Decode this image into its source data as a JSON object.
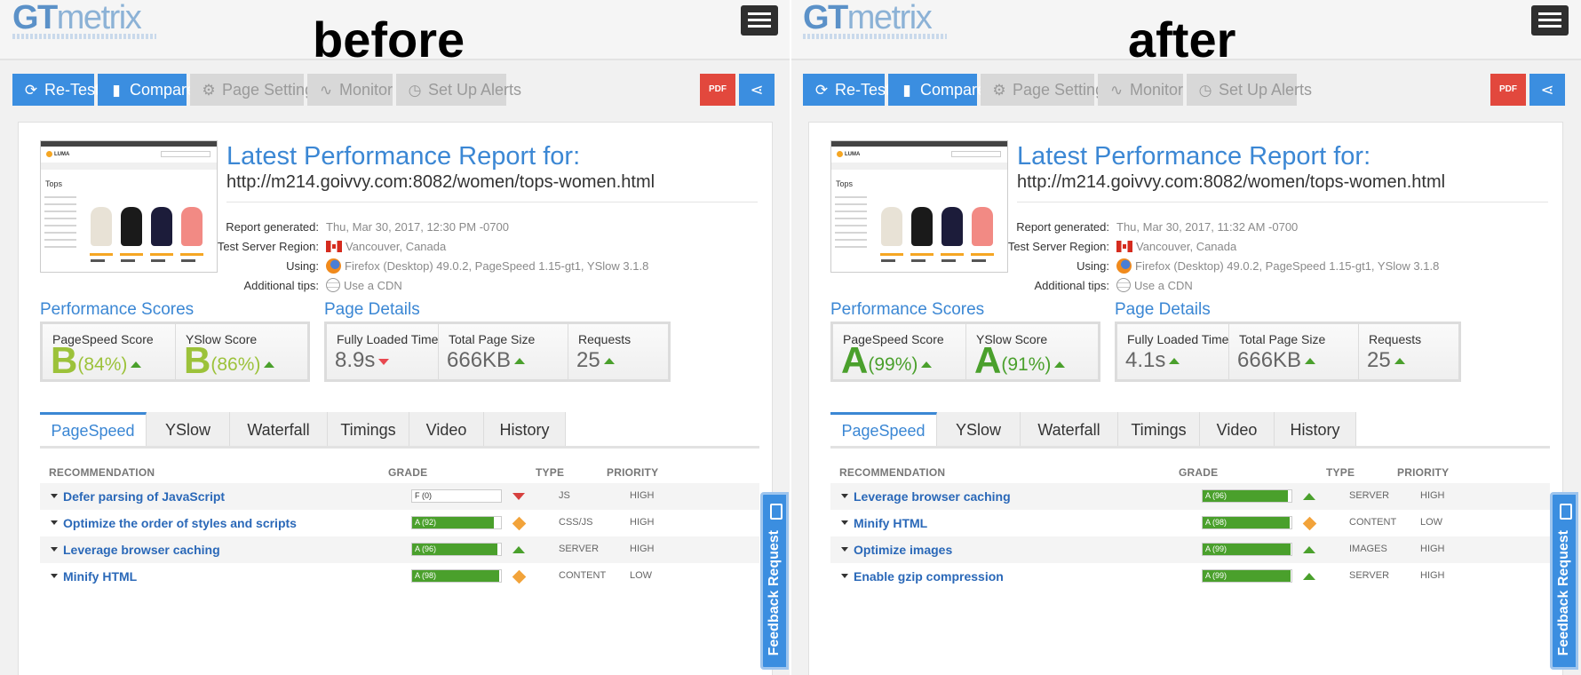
{
  "panels": [
    {
      "banner": "before",
      "logo": {
        "gt": "GT",
        "metrix": "metrix"
      },
      "toolbar": {
        "retest": "Re-Test",
        "compare": "Compare",
        "page_settings": "Page Settings",
        "monitor": "Monitor",
        "alerts": "Set Up Alerts",
        "pdf": "PDF"
      },
      "report": {
        "title": "Latest Performance Report for:",
        "url": "http://m214.goivvy.com:8082/women/tops-women.html"
      },
      "meta": {
        "generated_label": "Report generated:",
        "generated_value": "Thu, Mar 30, 2017, 12:30 PM -0700",
        "region_label": "Test Server Region:",
        "region_value": "Vancouver, Canada",
        "using_label": "Using:",
        "using_value": "Firefox (Desktop) 49.0.2, PageSpeed 1.15-gt1, YSlow 3.1.8",
        "tips_label": "Additional tips:",
        "tips_value": "Use a CDN"
      },
      "scores": {
        "title": "Performance Scores",
        "pagespeed_label": "PageSpeed Score",
        "pagespeed_grade": "B",
        "pagespeed_pct": "(84%)",
        "yslow_label": "YSlow Score",
        "yslow_grade": "B",
        "yslow_pct": "(86%)"
      },
      "details": {
        "title": "Page Details",
        "load_label": "Fully Loaded Time",
        "load_value": "8.9s",
        "load_trend": "down",
        "size_label": "Total Page Size",
        "size_value": "666KB",
        "req_label": "Requests",
        "req_value": "25"
      },
      "tabs": [
        "PageSpeed",
        "YSlow",
        "Waterfall",
        "Timings",
        "Video",
        "History"
      ],
      "table": {
        "h_rec": "RECOMMENDATION",
        "h_grade": "GRADE",
        "h_type": "TYPE",
        "h_prio": "PRIORITY"
      },
      "rows": [
        {
          "name": "Defer parsing of JavaScript",
          "grade": "F (0)",
          "score": 0,
          "trend": "down",
          "type": "JS",
          "priority": "HIGH"
        },
        {
          "name": "Optimize the order of styles and scripts",
          "grade": "A (92)",
          "score": 92,
          "trend": "same",
          "type": "CSS/JS",
          "priority": "HIGH"
        },
        {
          "name": "Leverage browser caching",
          "grade": "A (96)",
          "score": 96,
          "trend": "up",
          "type": "SERVER",
          "priority": "HIGH"
        },
        {
          "name": "Minify HTML",
          "grade": "A (98)",
          "score": 98,
          "trend": "same",
          "type": "CONTENT",
          "priority": "LOW"
        }
      ],
      "feedback": "Feedback Request"
    },
    {
      "banner": "after",
      "logo": {
        "gt": "GT",
        "metrix": "metrix"
      },
      "toolbar": {
        "retest": "Re-Test",
        "compare": "Compare",
        "page_settings": "Page Settings",
        "monitor": "Monitor",
        "alerts": "Set Up Alerts",
        "pdf": "PDF"
      },
      "report": {
        "title": "Latest Performance Report for:",
        "url": "http://m214.goivvy.com:8082/women/tops-women.html"
      },
      "meta": {
        "generated_label": "Report generated:",
        "generated_value": "Thu, Mar 30, 2017, 11:32 AM -0700",
        "region_label": "Test Server Region:",
        "region_value": "Vancouver, Canada",
        "using_label": "Using:",
        "using_value": "Firefox (Desktop) 49.0.2, PageSpeed 1.15-gt1, YSlow 3.1.8",
        "tips_label": "Additional tips:",
        "tips_value": "Use a CDN"
      },
      "scores": {
        "title": "Performance Scores",
        "pagespeed_label": "PageSpeed Score",
        "pagespeed_grade": "A",
        "pagespeed_pct": "(99%)",
        "yslow_label": "YSlow Score",
        "yslow_grade": "A",
        "yslow_pct": "(91%)"
      },
      "details": {
        "title": "Page Details",
        "load_label": "Fully Loaded Time",
        "load_value": "4.1s",
        "load_trend": "up",
        "size_label": "Total Page Size",
        "size_value": "666KB",
        "req_label": "Requests",
        "req_value": "25"
      },
      "tabs": [
        "PageSpeed",
        "YSlow",
        "Waterfall",
        "Timings",
        "Video",
        "History"
      ],
      "table": {
        "h_rec": "RECOMMENDATION",
        "h_grade": "GRADE",
        "h_type": "TYPE",
        "h_prio": "PRIORITY"
      },
      "rows": [
        {
          "name": "Leverage browser caching",
          "grade": "A (96)",
          "score": 96,
          "trend": "up",
          "type": "SERVER",
          "priority": "HIGH"
        },
        {
          "name": "Minify HTML",
          "grade": "A (98)",
          "score": 98,
          "trend": "same",
          "type": "CONTENT",
          "priority": "LOW"
        },
        {
          "name": "Optimize images",
          "grade": "A (99)",
          "score": 99,
          "trend": "up",
          "type": "IMAGES",
          "priority": "HIGH"
        },
        {
          "name": "Enable gzip compression",
          "grade": "A (99)",
          "score": 99,
          "trend": "up",
          "type": "SERVER",
          "priority": "HIGH"
        }
      ],
      "feedback": "Feedback Request"
    }
  ],
  "colors": {
    "accent": "#3b87d4",
    "button_blue": "#3b8ee0",
    "grade_a": "#4aa02c",
    "grade_b": "#9cc23a",
    "pdf_red": "#e2483d"
  }
}
